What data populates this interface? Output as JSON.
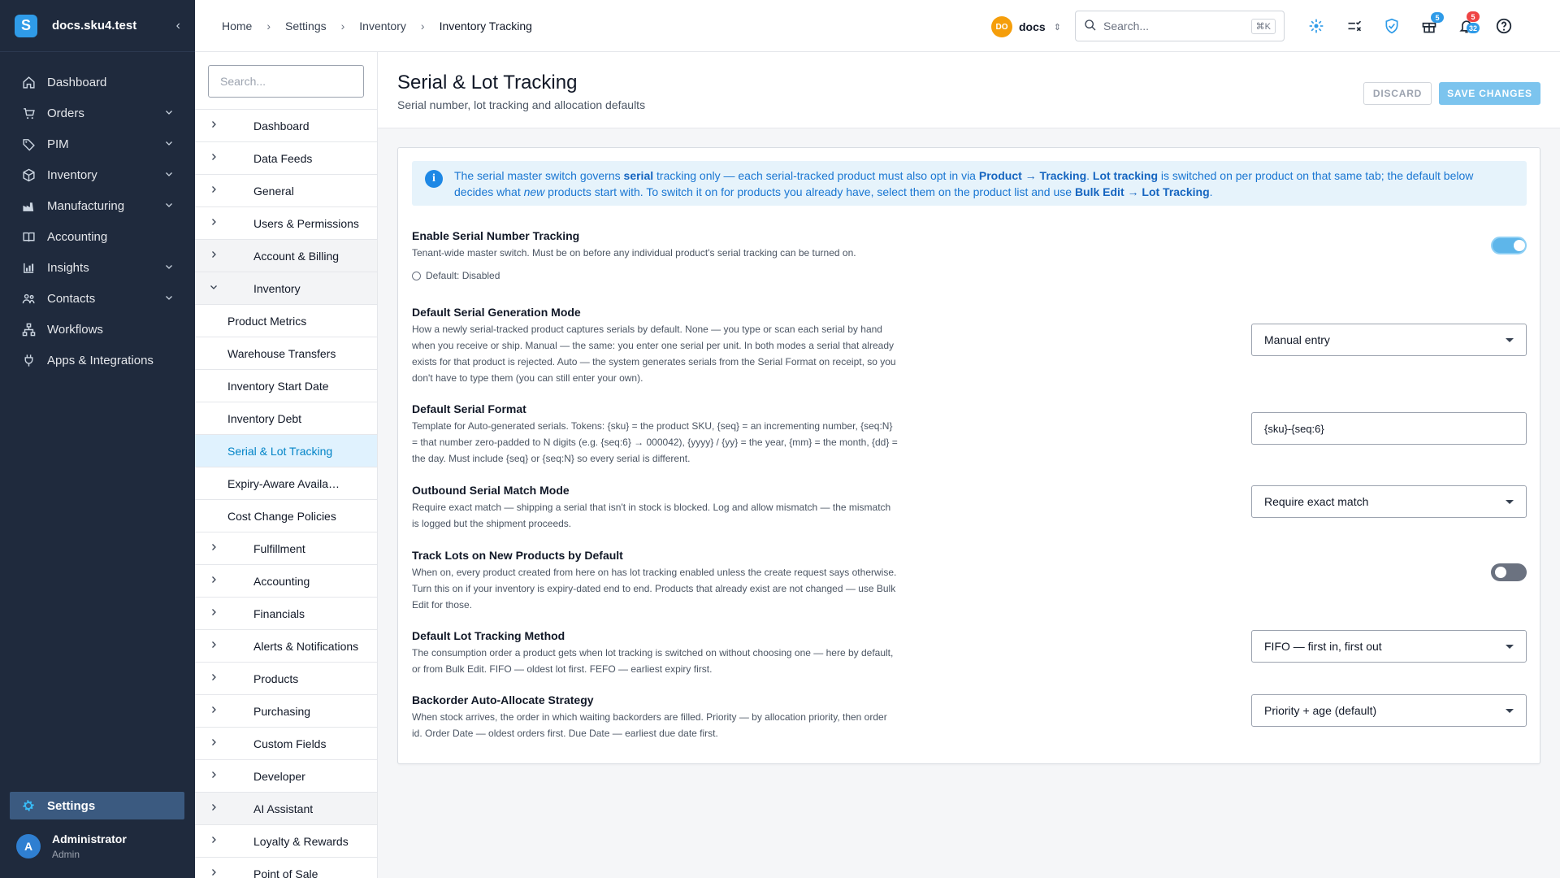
{
  "sidebar": {
    "brand": "docs.sku4.test",
    "brand_logo_letter": "S",
    "collapse_icon": "chevron-left-icon",
    "items": [
      {
        "label": "Dashboard",
        "icon": "home-icon",
        "has_children": false
      },
      {
        "label": "Orders",
        "icon": "cart-icon",
        "has_children": true
      },
      {
        "label": "PIM",
        "icon": "tag-icon",
        "has_children": true
      },
      {
        "label": "Inventory",
        "icon": "box-icon",
        "has_children": true
      },
      {
        "label": "Manufacturing",
        "icon": "factory-icon",
        "has_children": true
      },
      {
        "label": "Accounting",
        "icon": "book-icon",
        "has_children": false
      },
      {
        "label": "Insights",
        "icon": "chart-icon",
        "has_children": true
      },
      {
        "label": "Contacts",
        "icon": "people-icon",
        "has_children": true
      },
      {
        "label": "Workflows",
        "icon": "workflow-icon",
        "has_children": false
      },
      {
        "label": "Apps & Integrations",
        "icon": "plug-icon",
        "has_children": false
      }
    ],
    "settings_label": "Settings",
    "user": {
      "initial": "A",
      "name": "Administrator",
      "role": "Admin"
    }
  },
  "topbar": {
    "breadcrumbs": [
      "Home",
      "Settings",
      "Inventory",
      "Inventory Tracking"
    ],
    "workspace": {
      "initials": "DO",
      "name": "docs"
    },
    "search_placeholder": "Search...",
    "search_shortcut": "⌘K",
    "notif_badge": "5",
    "alerts_badge_top": "5",
    "alerts_badge_bottom": "32"
  },
  "subnav": {
    "search_placeholder": "Search...",
    "items": [
      {
        "label": "Dashboard",
        "kind": "section",
        "shaded": false
      },
      {
        "label": "Data Feeds",
        "kind": "section",
        "shaded": false
      },
      {
        "label": "General",
        "kind": "section",
        "shaded": false
      },
      {
        "label": "Users & Permissions",
        "kind": "section",
        "shaded": false
      },
      {
        "label": "Account & Billing",
        "kind": "section",
        "shaded": true
      },
      {
        "label": "Inventory",
        "kind": "expanded",
        "shaded": true
      },
      {
        "label": "Product Metrics",
        "kind": "child"
      },
      {
        "label": "Warehouse Transfers",
        "kind": "child"
      },
      {
        "label": "Inventory Start Date",
        "kind": "child"
      },
      {
        "label": "Inventory Debt",
        "kind": "child"
      },
      {
        "label": "Serial & Lot Tracking",
        "kind": "child",
        "active": true
      },
      {
        "label": "Expiry-Aware Availability",
        "kind": "child"
      },
      {
        "label": "Cost Change Policies",
        "kind": "child"
      },
      {
        "label": "Fulfillment",
        "kind": "section",
        "shaded": false
      },
      {
        "label": "Accounting",
        "kind": "section",
        "shaded": false
      },
      {
        "label": "Financials",
        "kind": "section",
        "shaded": false
      },
      {
        "label": "Alerts & Notifications",
        "kind": "section",
        "shaded": false
      },
      {
        "label": "Products",
        "kind": "section",
        "shaded": false
      },
      {
        "label": "Purchasing",
        "kind": "section",
        "shaded": false
      },
      {
        "label": "Custom Fields",
        "kind": "section",
        "shaded": false
      },
      {
        "label": "Developer",
        "kind": "section",
        "shaded": false
      },
      {
        "label": "AI Assistant",
        "kind": "section",
        "shaded": true
      },
      {
        "label": "Loyalty & Rewards",
        "kind": "section",
        "shaded": false
      },
      {
        "label": "Point of Sale",
        "kind": "section",
        "shaded": false
      }
    ]
  },
  "page": {
    "title": "Serial & Lot Tracking",
    "subtitle": "Serial number, lot tracking and allocation defaults",
    "discard_label": "DISCARD",
    "save_label": "SAVE CHANGES"
  },
  "info_banner": {
    "parts": [
      {
        "t": "The serial master switch governs "
      },
      {
        "t": "serial",
        "b": true
      },
      {
        "t": " tracking only — each serial-tracked product must also opt in via "
      },
      {
        "t": "Product → Tracking",
        "b": true
      },
      {
        "t": ". "
      },
      {
        "t": "Lot tracking",
        "b": true
      },
      {
        "t": " is switched on per product on that same tab; the default below decides what "
      },
      {
        "t": "new",
        "i": true
      },
      {
        "t": " products start with. To switch it on for products you already have, select them on the product list and use "
      },
      {
        "t": "Bulk Edit → Lot Tracking",
        "b": true
      },
      {
        "t": "."
      }
    ]
  },
  "settings": {
    "serial_tracking": {
      "title": "Enable Serial Number Tracking",
      "desc": "Tenant-wide master switch. Must be on before any individual product's serial tracking can be turned on.",
      "default_note": "Default: Disabled",
      "enabled": true
    },
    "generation_mode": {
      "title": "Default Serial Generation Mode",
      "desc": "How a newly serial-tracked product captures serials by default. None — you type or scan each serial by hand when you receive or ship. Manual — the same: you enter one serial per unit. In both modes a serial that already exists for that product is rejected. Auto — the system generates serials from the Serial Format on receipt, so you don't have to type them (you can still enter your own).",
      "value": "Manual entry"
    },
    "serial_format": {
      "title": "Default Serial Format",
      "desc": "Template for Auto-generated serials. Tokens: {sku} = the product SKU, {seq} = an incrementing number, {seq:N} = that number zero-padded to N digits (e.g. {seq:6} → 000042), {yyyy} / {yy} = the year, {mm} = the month, {dd} = the day. Must include {seq} or {seq:N} so every serial is different.",
      "value": "{sku}-{seq:6}"
    },
    "match_mode": {
      "title": "Outbound Serial Match Mode",
      "desc": "Require exact match — shipping a serial that isn't in stock is blocked. Log and allow mismatch — the mismatch is logged but the shipment proceeds.",
      "value": "Require exact match"
    },
    "track_lots": {
      "title": "Track Lots on New Products by Default",
      "desc": "When on, every product created from here on has lot tracking enabled unless the create request says otherwise. Turn this on if your inventory is expiry-dated end to end. Products that already exist are not changed — use Bulk Edit for those.",
      "enabled": false
    },
    "lot_method": {
      "title": "Default Lot Tracking Method",
      "desc": "The consumption order a product gets when lot tracking is switched on without choosing one — here by default, or from Bulk Edit. FIFO — oldest lot first. FEFO — earliest expiry first.",
      "value": "FIFO — first in, first out"
    },
    "backorder": {
      "title": "Backorder Auto-Allocate Strategy",
      "desc": "When stock arrives, the order in which waiting backorders are filled. Priority — by allocation priority, then order id. Order Date — oldest orders first. Due Date — earliest due date first.",
      "value": "Priority + age (default)"
    }
  },
  "colors": {
    "sidebar_bg": "#1f2a3d",
    "accent": "#2f9be8",
    "toggle_on": "#5eb6ea",
    "toggle_off": "#6b7280"
  }
}
